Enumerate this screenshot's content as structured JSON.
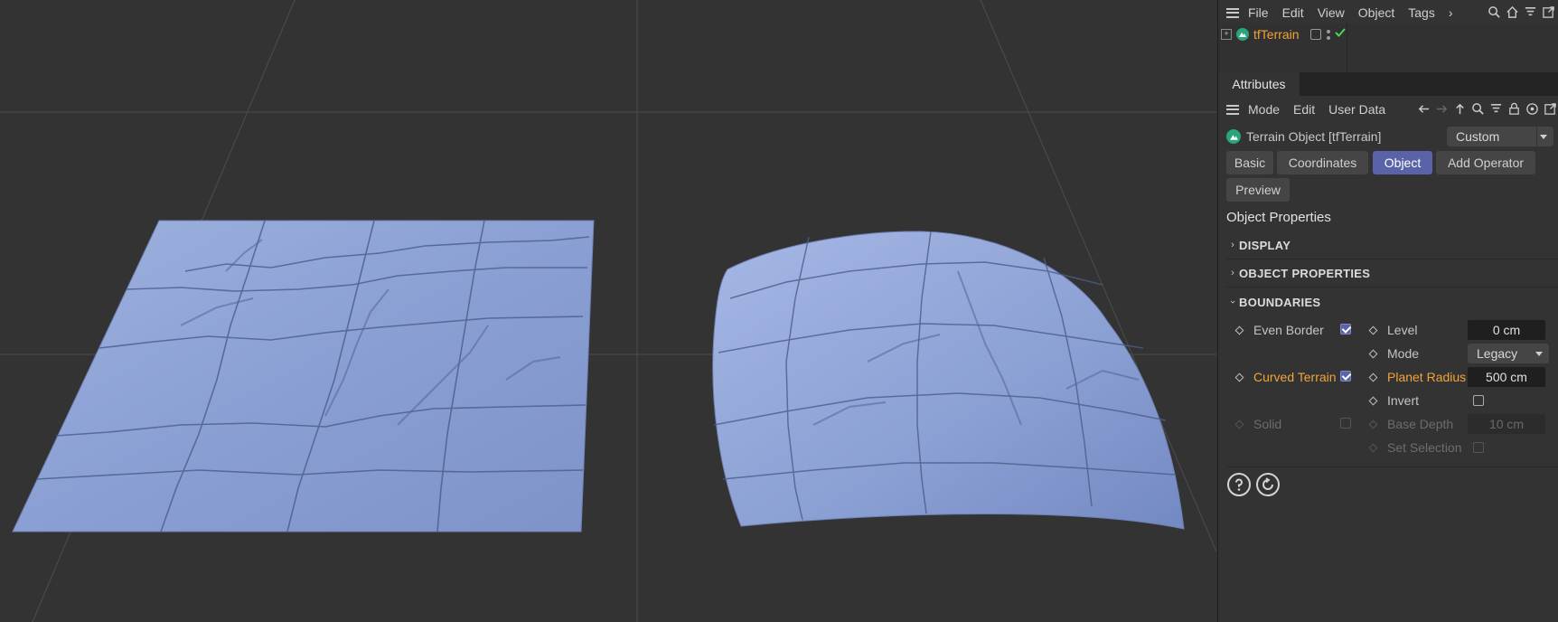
{
  "top_menu": {
    "items": [
      "File",
      "Edit",
      "View",
      "Object",
      "Tags"
    ],
    "more": "›"
  },
  "object_manager": {
    "object_name": "tfTerrain"
  },
  "attributes_tab": "Attributes",
  "attr_menu": {
    "items": [
      "Mode",
      "Edit",
      "User Data"
    ]
  },
  "object_header": {
    "title": "Terrain Object [tfTerrain]",
    "preset": "Custom"
  },
  "tabs": [
    "Basic",
    "Coordinates",
    "Object",
    "Add Operator",
    "Preview"
  ],
  "active_tab": "Object",
  "section_title": "Object Properties",
  "groups": {
    "display": "DISPLAY",
    "object_properties": "OBJECT PROPERTIES",
    "boundaries": "BOUNDARIES"
  },
  "boundaries": {
    "even_border": {
      "label": "Even Border",
      "checked": true
    },
    "curved_terrain": {
      "label": "Curved Terrain",
      "checked": true
    },
    "solid": {
      "label": "Solid",
      "checked": false
    },
    "level": {
      "label": "Level",
      "value": "0 cm"
    },
    "mode": {
      "label": "Mode",
      "value": "Legacy"
    },
    "planet_radius": {
      "label": "Planet Radius",
      "value": "500 cm"
    },
    "invert": {
      "label": "Invert",
      "checked": false
    },
    "base_depth": {
      "label": "Base Depth",
      "value": "10 cm"
    },
    "set_selection": {
      "label": "Set Selection",
      "checked": false
    }
  },
  "colors": {
    "terrain": "#8da3d6",
    "accent": "#5a63a8",
    "highlight": "#f3a33a",
    "viewport_bg": "#333333",
    "object_icon": "#38c9a0"
  }
}
